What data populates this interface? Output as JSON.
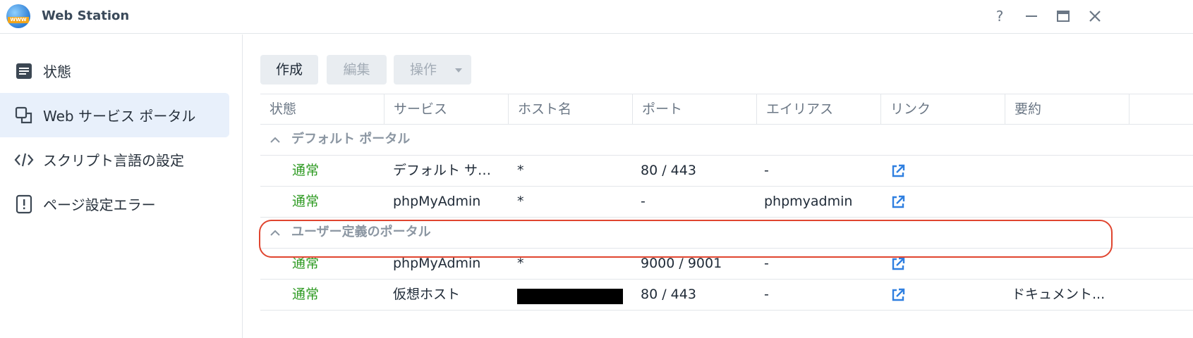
{
  "window": {
    "title": "Web Station",
    "logo_text": "WWW",
    "help_glyph": "?",
    "minimize_glyph": "—",
    "maximize_glyph": "▭",
    "close_glyph": "✕"
  },
  "sidebar": {
    "items": [
      {
        "label": "状態",
        "icon": "status-list-icon"
      },
      {
        "label": "Web サービス ポータル",
        "icon": "portal-icon",
        "active": true
      },
      {
        "label": "スクリプト言語の設定",
        "icon": "code-icon"
      },
      {
        "label": "ページ設定エラー",
        "icon": "error-page-icon"
      }
    ]
  },
  "toolbar": {
    "create_label": "作成",
    "edit_label": "編集",
    "action_label": "操作"
  },
  "table": {
    "columns": [
      "状態",
      "サービス",
      "ホスト名",
      "ポート",
      "エイリアス",
      "リンク",
      "要約"
    ],
    "groups": [
      {
        "title": "デフォルト ポータル",
        "rows": [
          {
            "status": "通常",
            "service": "デフォルト サー...",
            "host": "*",
            "port": "80 / 443",
            "alias": "-",
            "summary": ""
          },
          {
            "status": "通常",
            "service": "phpMyAdmin",
            "host": "*",
            "port": "-",
            "alias": "phpmyadmin",
            "summary": ""
          }
        ]
      },
      {
        "title": "ユーザー定義のポータル",
        "rows": [
          {
            "status": "通常",
            "service": "phpMyAdmin",
            "host": "*",
            "port": "9000 / 9001",
            "alias": "-",
            "summary": "",
            "highlighted": true
          },
          {
            "status": "通常",
            "service": "仮想ホスト",
            "host": "",
            "host_redacted": true,
            "port": "80 / 443",
            "alias": "-",
            "summary": "ドキュメント..."
          }
        ]
      }
    ]
  },
  "colors": {
    "status_ok": "#2e9a22",
    "link_icon": "#2f7fe0",
    "highlight": "#e0452f",
    "active_nav_bg": "#e8f0fb"
  }
}
